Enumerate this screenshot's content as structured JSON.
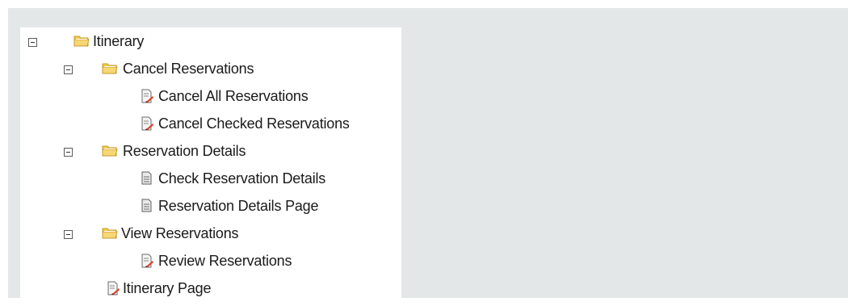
{
  "tree": {
    "nodes": [
      {
        "label": "Itinerary",
        "type": "folder"
      },
      {
        "label": "Cancel Reservations",
        "type": "folder"
      },
      {
        "label": "Cancel All Reservations",
        "type": "script"
      },
      {
        "label": "Cancel Checked Reservations",
        "type": "script"
      },
      {
        "label": "Reservation Details",
        "type": "folder"
      },
      {
        "label": "Check Reservation Details",
        "type": "document"
      },
      {
        "label": "Reservation Details Page",
        "type": "document"
      },
      {
        "label": "View Reservations",
        "type": "folder"
      },
      {
        "label": "Review Reservations",
        "type": "script"
      },
      {
        "label": "Itinerary Page",
        "type": "script"
      }
    ]
  },
  "colors": {
    "panel_background": "#e4e7e8",
    "folder_fill": "#f7d774",
    "folder_edge": "#c79a2a",
    "script_accent": "#d9412b"
  }
}
